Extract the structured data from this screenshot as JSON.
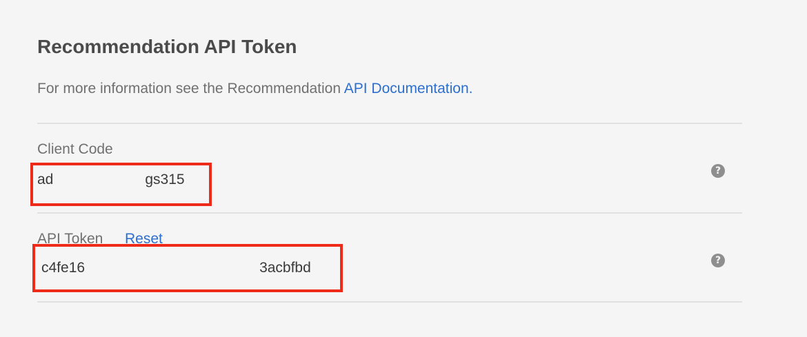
{
  "section": {
    "title": "Recommendation API Token",
    "info_text": "For more information see the Recommendation",
    "info_link": "API Documentation."
  },
  "client_code": {
    "label": "Client Code",
    "value_start": "ad",
    "value_end": "gs315",
    "help_icon": "question-circle-icon"
  },
  "api_token": {
    "label": "API Token",
    "reset_label": "Reset",
    "value_start": "c4fe16",
    "value_end": "3acbfbd",
    "help_icon": "question-circle-icon"
  },
  "colors": {
    "link": "#2d6fcf",
    "highlight": "#f02a18",
    "background": "#f5f5f5"
  }
}
